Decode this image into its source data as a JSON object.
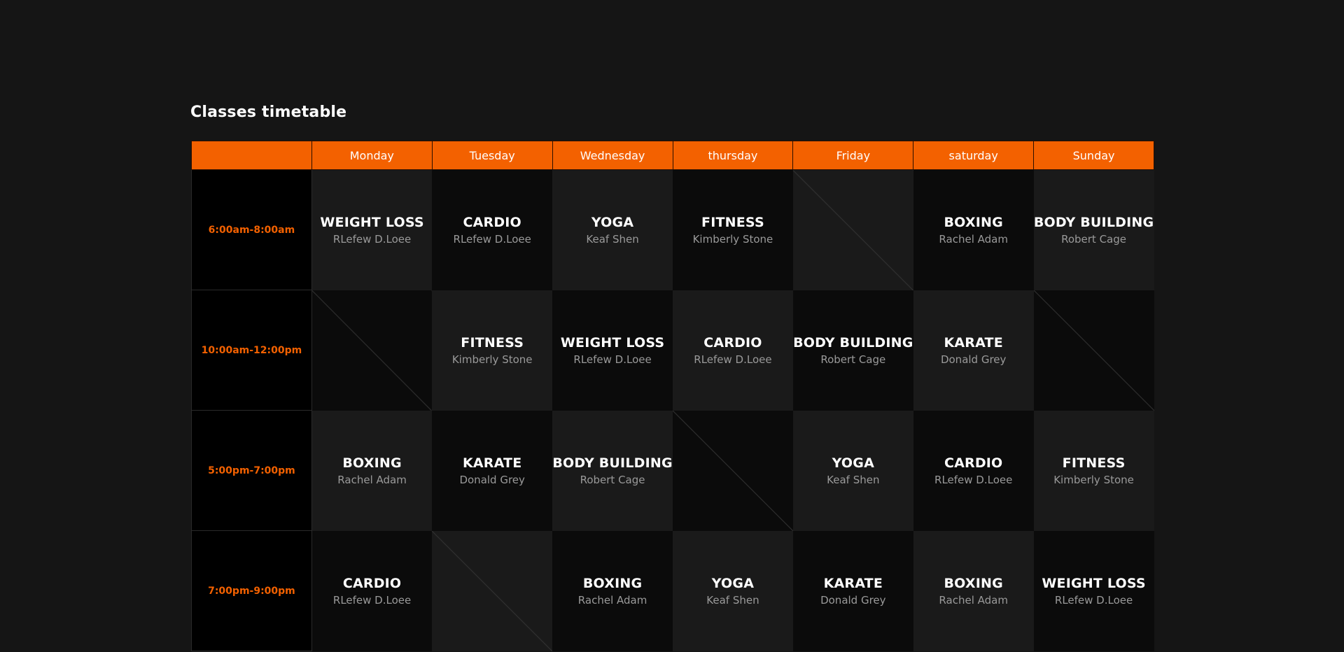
{
  "title": "Classes timetable",
  "days": [
    "Monday",
    "Tuesday",
    "Wednesday",
    "thursday",
    "Friday",
    "saturday",
    "Sunday"
  ],
  "rows": [
    {
      "time": "6:00am-8:00am",
      "cells": [
        {
          "name": "WEIGHT LOSS",
          "trainer": "RLefew D.Loee"
        },
        {
          "name": "CARDIO",
          "trainer": "RLefew D.Loee"
        },
        {
          "name": "YOGA",
          "trainer": "Keaf Shen"
        },
        {
          "name": "FITNESS",
          "trainer": "Kimberly Stone"
        },
        null,
        {
          "name": "BOXING",
          "trainer": "Rachel Adam"
        },
        {
          "name": "BODY BUILDING",
          "trainer": "Robert Cage"
        }
      ]
    },
    {
      "time": "10:00am-12:00pm",
      "cells": [
        null,
        {
          "name": "FITNESS",
          "trainer": "Kimberly Stone"
        },
        {
          "name": "WEIGHT LOSS",
          "trainer": "RLefew D.Loee"
        },
        {
          "name": "CARDIO",
          "trainer": "RLefew D.Loee"
        },
        {
          "name": "BODY BUILDING",
          "trainer": "Robert Cage"
        },
        {
          "name": "KARATE",
          "trainer": "Donald Grey"
        },
        null
      ]
    },
    {
      "time": "5:00pm-7:00pm",
      "cells": [
        {
          "name": "BOXING",
          "trainer": "Rachel Adam"
        },
        {
          "name": "KARATE",
          "trainer": "Donald Grey"
        },
        {
          "name": "BODY BUILDING",
          "trainer": "Robert Cage"
        },
        null,
        {
          "name": "YOGA",
          "trainer": "Keaf Shen"
        },
        {
          "name": "CARDIO",
          "trainer": "RLefew D.Loee"
        },
        {
          "name": "FITNESS",
          "trainer": "Kimberly Stone"
        }
      ]
    },
    {
      "time": "7:00pm-9:00pm",
      "cells": [
        {
          "name": "CARDIO",
          "trainer": "RLefew D.Loee"
        },
        null,
        {
          "name": "BOXING",
          "trainer": "Rachel Adam"
        },
        {
          "name": "YOGA",
          "trainer": "Keaf Shen"
        },
        {
          "name": "KARATE",
          "trainer": "Donald Grey"
        },
        {
          "name": "BOXING",
          "trainer": "Rachel Adam"
        },
        {
          "name": "WEIGHT LOSS",
          "trainer": "RLefew D.Loee"
        }
      ]
    }
  ],
  "colors": {
    "accent": "#f36100",
    "background": "#151515",
    "cell_dark": "#0b0b0b",
    "cell_light": "#1a1a1a"
  }
}
